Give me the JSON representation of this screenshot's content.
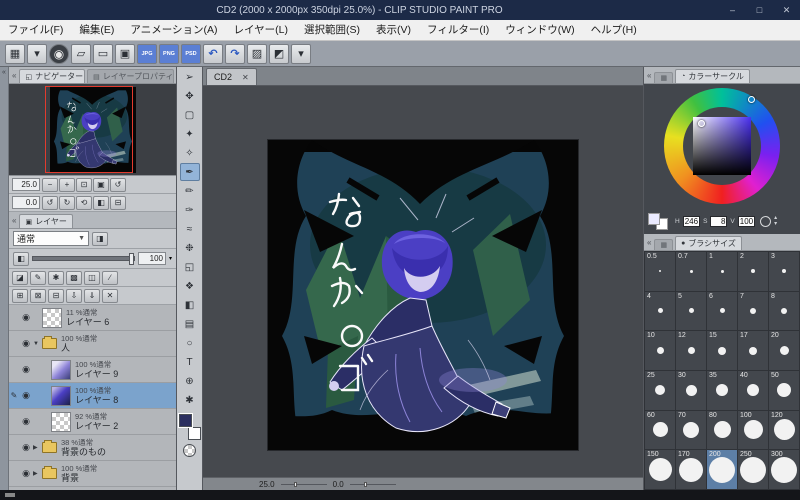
{
  "window": {
    "title": "CD2 (2000 x 2000px 350dpi 25.0%)  - CLIP STUDIO PAINT PRO",
    "minimize_label": "–",
    "maximize_label": "□",
    "close_label": "✕"
  },
  "chrome": {
    "collapse_left": "«",
    "collapse_right": "»"
  },
  "menu": {
    "items": [
      "ファイル(F)",
      "編集(E)",
      "アニメーション(A)",
      "レイヤー(L)",
      "選択範囲(S)",
      "表示(V)",
      "フィルター(I)",
      "ウィンドウ(W)",
      "ヘルプ(H)"
    ]
  },
  "toolbar": {
    "buttons": [
      {
        "name": "workspace-grid-button",
        "glyph": "▦",
        "type": "icon"
      },
      {
        "name": "workspace-dropdown",
        "glyph": "▾",
        "type": "icon"
      },
      {
        "name": "clip-studio-logo-button",
        "glyph": "◉",
        "type": "logo"
      },
      {
        "name": "new-canvas-button",
        "glyph": "▱",
        "type": "icon"
      },
      {
        "name": "open-file-button",
        "glyph": "▭",
        "type": "icon"
      },
      {
        "name": "save-button",
        "glyph": "▣",
        "type": "icon"
      },
      {
        "name": "export-jpg-button",
        "glyph": "JPG",
        "type": "chip"
      },
      {
        "name": "export-png-button",
        "glyph": "PNG",
        "type": "chip"
      },
      {
        "name": "export-psd-button",
        "glyph": "PSD",
        "type": "chip"
      },
      {
        "name": "undo-button",
        "glyph": "↶",
        "type": "arrow"
      },
      {
        "name": "redo-button",
        "glyph": "↷",
        "type": "arrow"
      },
      {
        "name": "clear-button",
        "glyph": "▨",
        "type": "icon"
      },
      {
        "name": "color-settings-button",
        "glyph": "◩",
        "type": "icon"
      },
      {
        "name": "toolbar-overflow-dropdown",
        "glyph": "▾",
        "type": "icon"
      }
    ]
  },
  "navigator": {
    "tab_active": "ナビゲーター",
    "tab_inactive": "レイヤープロパティ",
    "zoom_value": "25.0",
    "zoom_buttons": [
      {
        "name": "zoom-out-button",
        "glyph": "−"
      },
      {
        "name": "zoom-in-button",
        "glyph": "+"
      },
      {
        "name": "fit-to-window-button",
        "glyph": "⊡"
      },
      {
        "name": "actual-size-button",
        "glyph": "▣"
      },
      {
        "name": "reset-zoom-button",
        "glyph": "↺"
      }
    ],
    "rotate_value": "0.0",
    "rotate_buttons": [
      {
        "name": "rotate-left-button",
        "glyph": "↺"
      },
      {
        "name": "rotate-right-button",
        "glyph": "↻"
      },
      {
        "name": "reset-rotation-button",
        "glyph": "⟲"
      },
      {
        "name": "flip-horizontal-button",
        "glyph": "◧"
      },
      {
        "name": "flip-vertical-button",
        "glyph": "⊟"
      }
    ]
  },
  "layers_panel": {
    "tab": "レイヤー",
    "blend_mode": "通常",
    "opacity_label": "100",
    "cmd_row1": [
      {
        "name": "change-palette-color-button",
        "glyph": "◪"
      },
      {
        "name": "draft-layer-button",
        "glyph": "✎"
      },
      {
        "name": "lock-layer-button",
        "glyph": "✱"
      },
      {
        "name": "lock-transparent-pixel-button",
        "glyph": "▩"
      },
      {
        "name": "enable-mask-button",
        "glyph": "◫"
      },
      {
        "name": "set-ruler-button",
        "glyph": "∕"
      }
    ],
    "cmd_row2": [
      {
        "name": "new-raster-layer-button",
        "glyph": "⊞"
      },
      {
        "name": "new-vector-layer-button",
        "glyph": "⊠"
      },
      {
        "name": "new-folder-button",
        "glyph": "⊟"
      },
      {
        "name": "merge-down-button",
        "glyph": "⇩"
      },
      {
        "name": "transfer-to-lower-button",
        "glyph": "⇓"
      },
      {
        "name": "delete-layer-button",
        "glyph": "✕"
      }
    ],
    "rows": [
      {
        "opacity_label": "11 %通常",
        "name": "レイヤー 6",
        "kind": "layer",
        "indent": 0,
        "eye": true,
        "thumb": "checker",
        "selected": false,
        "editing": false,
        "expand": ""
      },
      {
        "opacity_label": "100 %通常",
        "name": "人",
        "kind": "folder",
        "indent": 0,
        "eye": true,
        "thumb": "",
        "selected": false,
        "editing": false,
        "expand": "▼"
      },
      {
        "opacity_label": "100 %通常",
        "name": "レイヤー 9",
        "kind": "layer",
        "indent": 1,
        "eye": true,
        "thumb": "art-light",
        "selected": false,
        "editing": false,
        "expand": ""
      },
      {
        "opacity_label": "100 %通常",
        "name": "レイヤー 8",
        "kind": "layer",
        "indent": 1,
        "eye": true,
        "thumb": "art-dark",
        "selected": true,
        "editing": true,
        "expand": ""
      },
      {
        "opacity_label": "92 %通常",
        "name": "レイヤー 2",
        "kind": "layer",
        "indent": 1,
        "eye": true,
        "thumb": "checker",
        "selected": false,
        "editing": false,
        "expand": ""
      },
      {
        "opacity_label": "38 %通常",
        "name": "背景のもの",
        "kind": "folder",
        "indent": 0,
        "eye": true,
        "thumb": "",
        "selected": false,
        "editing": false,
        "expand": "▶"
      },
      {
        "opacity_label": "100 %通常",
        "name": "背景",
        "kind": "folder",
        "indent": 0,
        "eye": true,
        "thumb": "",
        "selected": false,
        "editing": false,
        "expand": "▶"
      }
    ]
  },
  "tools": {
    "selected_index": 5,
    "main_color": "#2b2f60",
    "sub_color": "#ffffff",
    "items": [
      {
        "name": "operate-tool",
        "glyph": "➢"
      },
      {
        "name": "layer-move-tool",
        "glyph": "✥"
      },
      {
        "name": "selection-tool",
        "glyph": "▢"
      },
      {
        "name": "auto-select-tool",
        "glyph": "✦"
      },
      {
        "name": "eyedropper-tool",
        "glyph": "✧"
      },
      {
        "name": "pen-tool",
        "glyph": "✒"
      },
      {
        "name": "pencil-tool",
        "glyph": "✏"
      },
      {
        "name": "brush-tool",
        "glyph": "✑"
      },
      {
        "name": "airbrush-tool",
        "glyph": "≈"
      },
      {
        "name": "decoration-tool",
        "glyph": "❉"
      },
      {
        "name": "eraser-tool",
        "glyph": "◱"
      },
      {
        "name": "blend-tool",
        "glyph": "❖"
      },
      {
        "name": "fill-tool",
        "glyph": "◧"
      },
      {
        "name": "gradient-tool",
        "glyph": "▤"
      },
      {
        "name": "figure-tool",
        "glyph": "○"
      },
      {
        "name": "text-tool",
        "glyph": "T"
      },
      {
        "name": "zoom-tool",
        "glyph": "⊕"
      },
      {
        "name": "hand-tool",
        "glyph": "✱"
      }
    ]
  },
  "canvas": {
    "tab_label": "CD2",
    "close_label": "✕",
    "status_zoom": "25.0",
    "status_rotation": "0.0",
    "graffiti_text": "なんか○ゴ"
  },
  "color_panel": {
    "tab": "カラーサークル",
    "h_label": "H",
    "s_label": "S",
    "v_label": "V",
    "hue": "246",
    "saturation": "8",
    "value": "100",
    "current_color": "#ebebff",
    "sub_color": "#ffffff"
  },
  "brush_panel": {
    "tab": "ブラシサイズ",
    "selected_size": 200,
    "rows": [
      [
        0.5,
        0.7,
        1,
        2,
        3
      ],
      [
        4,
        5,
        6,
        7,
        8
      ],
      [
        10,
        12,
        15,
        17,
        20
      ],
      [
        25,
        30,
        35,
        40,
        50
      ],
      [
        60,
        70,
        80,
        100,
        120
      ],
      [
        150,
        170,
        200,
        250,
        300
      ]
    ]
  }
}
